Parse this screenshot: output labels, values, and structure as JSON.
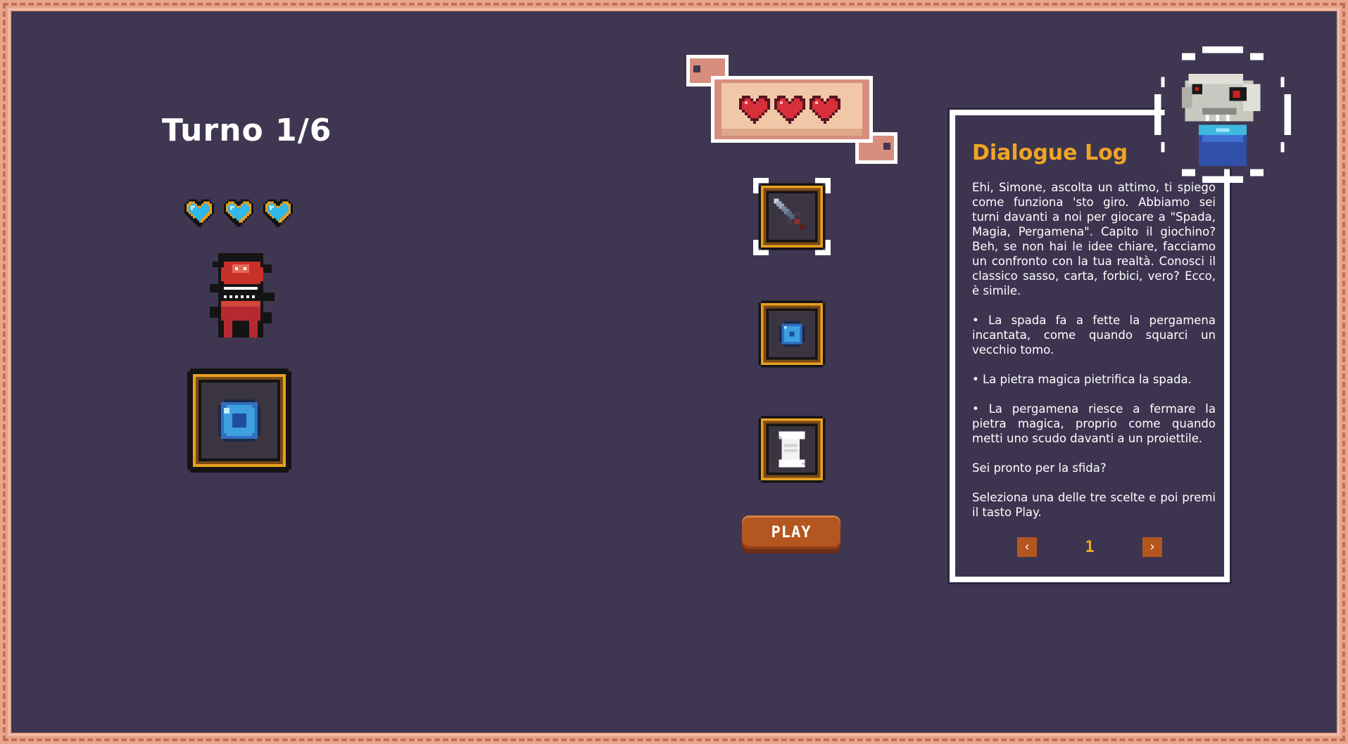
{
  "game": {
    "turn_label": "Turno 1/6",
    "play_label": "PLAY",
    "enemy_lives": 3,
    "player_lives": 3,
    "enemy_choice_icon": "magic-gem-icon",
    "choices": [
      {
        "name": "sword",
        "icon": "sword-icon"
      },
      {
        "name": "gem",
        "icon": "magic-gem-icon"
      },
      {
        "name": "scroll",
        "icon": "scroll-icon"
      }
    ]
  },
  "dialogue": {
    "title": "Dialogue Log",
    "paragraphs": [
      "Ehi, Simone, ascolta un attimo, ti spiego come funziona 'sto giro. Abbiamo sei turni davanti a noi per giocare a \"Spada, Magia, Pergamena\". Capito il giochino? Beh, se non hai le idee chiare, facciamo un confronto con la tua realtà. Conosci il classico sasso, carta, forbici, vero? Ecco, è simile.",
      "• La spada fa a fette la pergamena incantata, come quando squarci un vecchio tomo.",
      "• La pietra magica pietrifica la spada.",
      "• La pergamena riesce a fermare la pietra magica, proprio come quando metti uno scudo davanti a un proiettile.",
      "Sei pronto per la sfida?",
      "Seleziona una delle tre scelte e poi premi il tasto Play."
    ],
    "page": "1",
    "prev_icon": "chevron-left-icon",
    "next_icon": "chevron-right-icon"
  },
  "colors": {
    "background": "#3f3752",
    "border": "#e8a58a",
    "accent": "#f0a524",
    "button": "#b4561f",
    "heart_red": "#d8303a",
    "heart_blue": "#2fb8e8"
  }
}
